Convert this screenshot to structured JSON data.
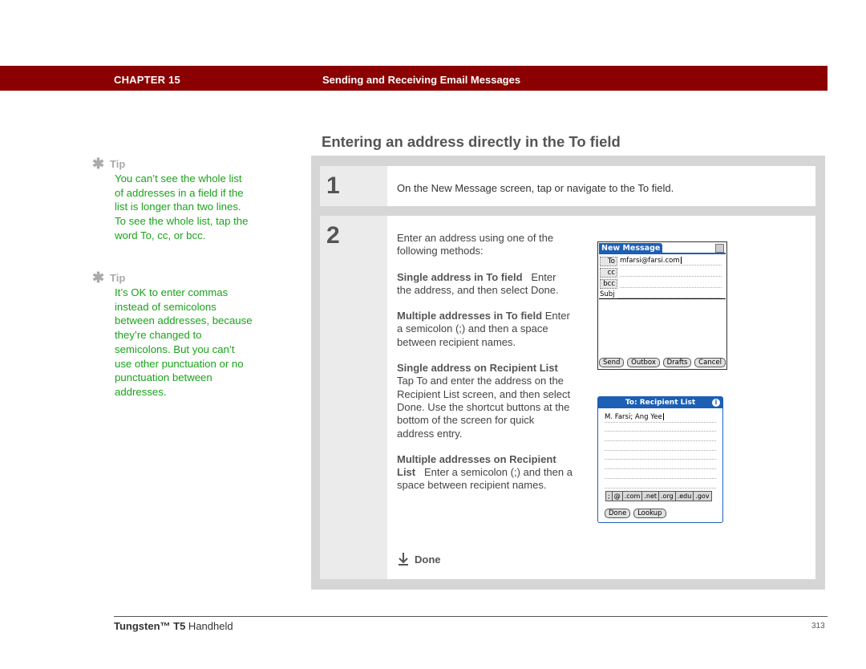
{
  "header": {
    "chapter": "CHAPTER 15",
    "chapter_title": "Sending and Receiving Email Messages",
    "bar_color": "#8b0000"
  },
  "tips": [
    {
      "label": "Tip",
      "icon": "asterisk-icon",
      "text": "You can’t see the whole list of addresses in a field if the list is longer than two lines. To see the whole list, tap the word To, cc, or bcc."
    },
    {
      "label": "Tip",
      "icon": "asterisk-icon",
      "text": "It’s OK to enter commas instead of semicolons between addresses, because they’re changed to semicolons. But you can’t use other punctuation or no punctuation between addresses."
    }
  ],
  "section": {
    "title": "Entering an address directly in the To field"
  },
  "steps": [
    {
      "number": "1",
      "text": "On the New Message screen, tap or navigate to the To field."
    },
    {
      "number": "2",
      "intro": "Enter an address using one of the following methods:",
      "methods": [
        {
          "title": "Single address in To field",
          "text": "Enter the address, and then select Done."
        },
        {
          "title": "Multiple addresses in To field",
          "text": "Enter a semicolon (;) and then a space between recipient names."
        },
        {
          "title": "Single address on Recipient List",
          "text": "Tap To and enter the address on the Recipient List screen, and then select Done. Use the shortcut buttons at the bottom of the screen for quick address entry."
        },
        {
          "title": "Multiple addresses on Recipient List",
          "text": "Enter a semicolon (;) and then a space between recipient names."
        }
      ],
      "done_label": "Done"
    }
  ],
  "screen_new_message": {
    "title": "New Message",
    "fields": [
      {
        "label": "To",
        "value": "mfarsi@farsi.com"
      },
      {
        "label": "cc",
        "value": ""
      },
      {
        "label": "bcc",
        "value": ""
      },
      {
        "label": "Subj",
        "value": ""
      }
    ],
    "buttons": [
      "Send",
      "Outbox",
      "Drafts",
      "Cancel"
    ]
  },
  "screen_recipient_list": {
    "title": "To: Recipient List",
    "value": "M. Farsi; Ang Yee",
    "shortcuts": [
      ";",
      "@",
      ".com",
      ".net",
      ".org",
      ".edu",
      ".gov"
    ],
    "buttons": [
      "Done",
      "Lookup"
    ]
  },
  "footer": {
    "product_bold": "Tungsten™ T5",
    "product_rest": " Handheld",
    "page_number": "313"
  }
}
